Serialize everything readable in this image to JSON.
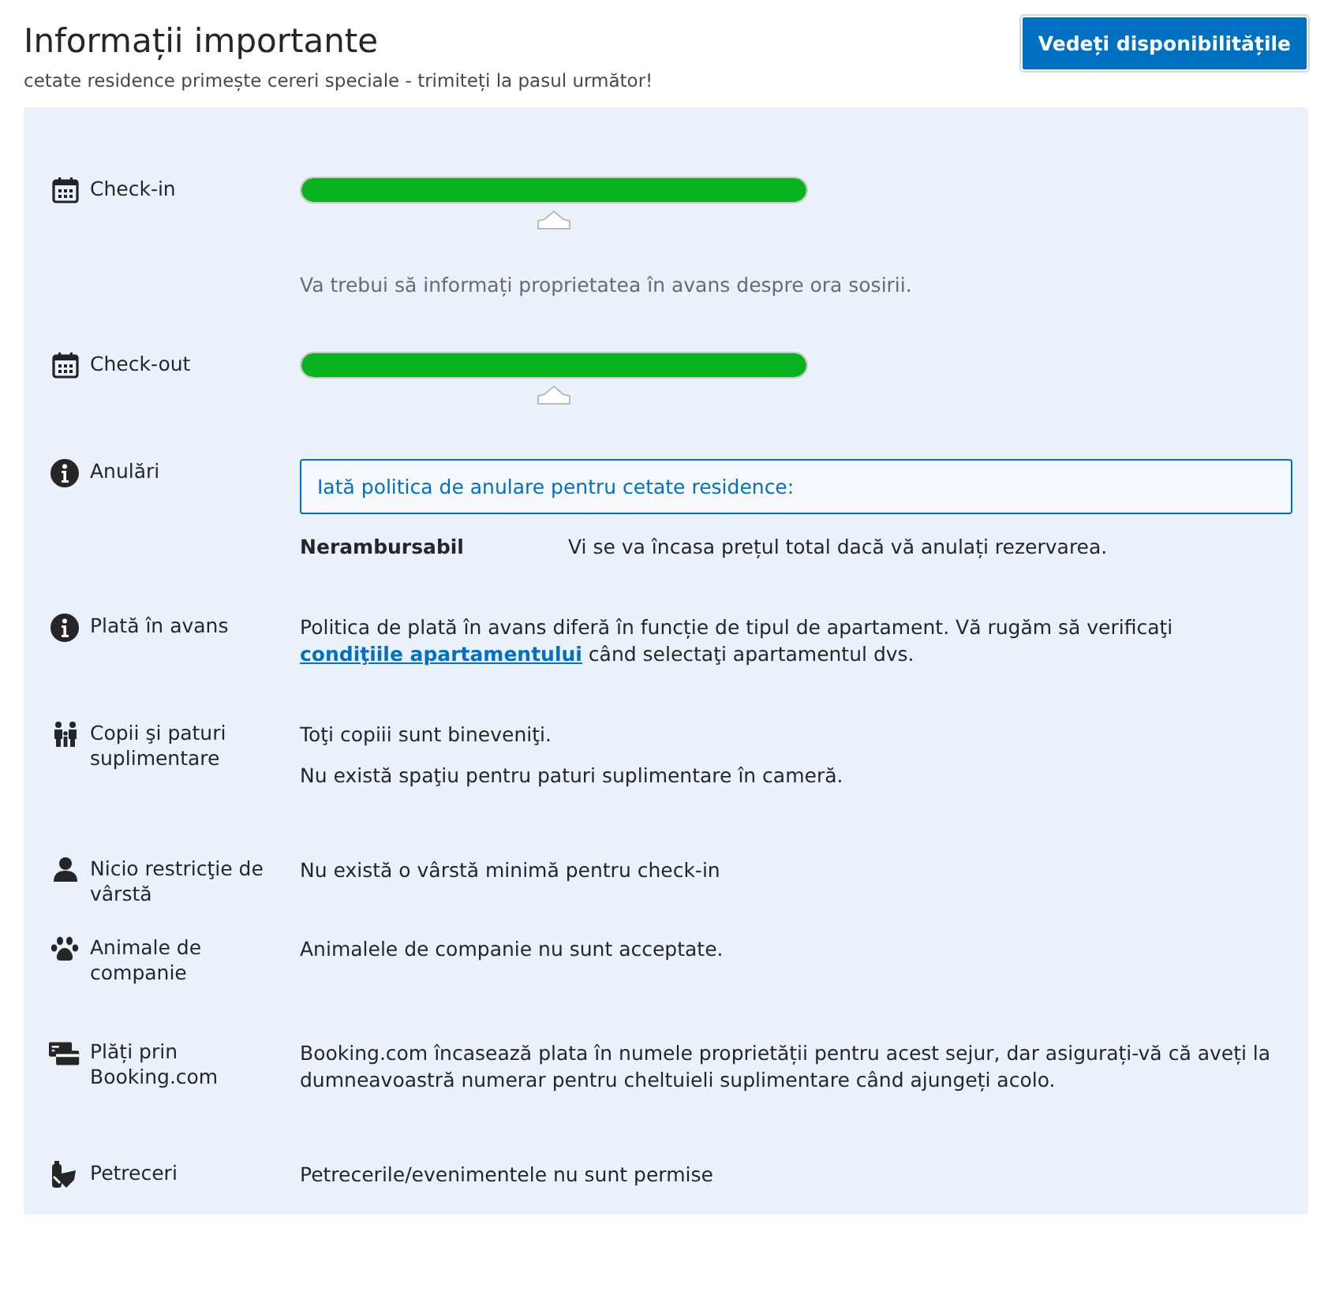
{
  "header": {
    "title": "Informații importante",
    "subtitle": "cetate residence primește cereri speciale - trimiteți la pasul următor!",
    "button": "Vedeți disponibilitățile"
  },
  "rules": [
    {
      "kind": "timeline",
      "label": "Check-in",
      "level": 1,
      "note": "Va trebui să informați proprietatea în avans despre ora sosirii."
    },
    {
      "kind": "timeline",
      "label": "Check-out",
      "level": 1
    },
    {
      "kind": "policy",
      "label": "Anulări",
      "box": "Iată politica de anulare pentru cetate residence:",
      "policy_name": "Nerambursabil",
      "policy_text": "Vi se va încasa prețul total dacă vă anulați rezervarea."
    },
    {
      "kind": "link_text",
      "label": "Plată în avans",
      "before": "Politica de plată în avans diferă în funcție de tipul de apartament. Vă rugăm să verificaţi",
      "link": "condiţiile apartamentului",
      "after": "când selectaţi apartamentul dvs."
    },
    {
      "kind": "text",
      "label": "Copii şi paturi suplimentare",
      "paragraphs": [
        "Toţi copiii sunt bineveniţi.",
        "Nu există spaţiu pentru paturi suplimentare în cameră."
      ]
    },
    {
      "kind": "text",
      "label": "Nicio restricţie de vârstă",
      "paragraphs": [
        "Nu există o vârstă minimă pentru check-in"
      ]
    },
    {
      "kind": "text",
      "label": "Animale de companie",
      "paragraphs": [
        "Animalele de companie nu sunt acceptate."
      ]
    },
    {
      "kind": "text",
      "label": "Plăți prin Booking.com",
      "paragraphs": [
        "Booking.com încasează plata în numele proprietății pentru acest sejur, dar asigurați-vă că aveți la dumneavoastră numerar pentru cheltuieli suplimentare când ajungeți acolo."
      ]
    },
    {
      "kind": "text",
      "label": "Petreceri",
      "paragraphs": [
        "Petrecerile/evenimentele nu sunt permise"
      ]
    }
  ]
}
